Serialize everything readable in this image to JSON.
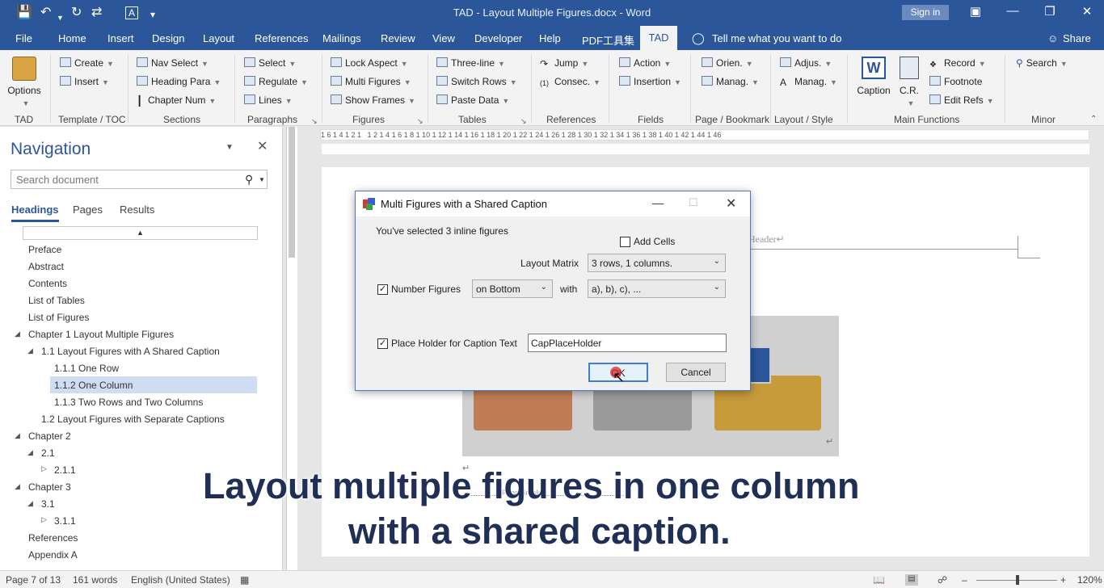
{
  "app": {
    "title": "TAD - Layout Multiple Figures.docx - Word",
    "signin": "Sign in"
  },
  "menu_tabs": [
    "File",
    "Home",
    "Insert",
    "Design",
    "Layout",
    "References",
    "Mailings",
    "Review",
    "View",
    "Developer",
    "Help",
    "PDF工具集",
    "TAD"
  ],
  "tell_me": "Tell me what you want to do",
  "share": "Share",
  "ribbon": {
    "options": "Options",
    "template_toc": {
      "create": "Create",
      "insert": "Insert",
      "label": "Template / TOC"
    },
    "tad_label": "TAD",
    "sections": {
      "nav_select": "Nav Select",
      "heading_para": "Heading Para",
      "chapter_num": "Chapter Num",
      "label": "Sections"
    },
    "paragraphs": {
      "select": "Select",
      "regulate": "Regulate",
      "lines": "Lines",
      "label": "Paragraphs"
    },
    "figures": {
      "lock_aspect": "Lock Aspect",
      "multi_figures": "Multi Figures",
      "show_frames": "Show Frames",
      "label": "Figures"
    },
    "tables": {
      "three_line": "Three-line",
      "switch_rows": "Switch Rows",
      "paste_data": "Paste Data",
      "label": "Tables"
    },
    "references": {
      "jump": "Jump",
      "consec": "Consec.",
      "label": "References"
    },
    "fields": {
      "action": "Action",
      "insertion": "Insertion",
      "label": "Fields"
    },
    "page_bookmark": {
      "orien": "Orien.",
      "manag": "Manag.",
      "label": "Page / Bookmark"
    },
    "layout_style": {
      "adjus": "Adjus.",
      "manag": "Manag.",
      "label": "Layout / Style"
    },
    "main_functions": {
      "caption": "Caption",
      "cr": "C.R.",
      "record": "Record",
      "footnote": "Footnote",
      "edit_refs": "Edit Refs",
      "label": "Main Functions"
    },
    "minor": {
      "search": "Search",
      "label": "Minor"
    }
  },
  "nav": {
    "title": "Navigation",
    "search_placeholder": "Search document",
    "tabs": [
      "Headings",
      "Pages",
      "Results"
    ],
    "items": [
      "Preface",
      "Abstract",
      "Contents",
      "List of Tables",
      "List of Figures",
      "Chapter 1 Layout Multiple Figures",
      "1.1 Layout Figures with A Shared Caption",
      "1.1.1 One Row",
      "1.1.2 One Column",
      "1.1.3 Two Rows and Two Columns",
      "1.2 Layout Figures with Separate Captions",
      "Chapter 2",
      "2.1",
      "2.1.1",
      "Chapter 3",
      "3.1",
      "3.1.1",
      "References",
      "Appendix A"
    ]
  },
  "hruler_text": "1 6 1 4 1 2 1   1 2 1 4 1 6 1 8 1 10 1 12 1 14 1 16 1 18 1 20 1 22 1 24 1 26 1 28 1 30 1 32 1 34 1 36 1 38 1 40 1 42 1 44 1 46",
  "document": {
    "header_text": "Header↵",
    "para_mark": "↵",
    "page_break": "Page Break"
  },
  "dialog": {
    "title": "Multi Figures with a Shared Caption",
    "selected_info": "You've selected 3 inline figures",
    "add_cells": "Add Cells",
    "layout_matrix_label": "Layout Matrix",
    "layout_matrix_value": "3 rows, 1 columns.",
    "number_figures": "Number Figures",
    "position_value": "on Bottom",
    "with_label": "with",
    "numbering_value": "a), b), c), ...",
    "placeholder_label": "Place Holder for Caption Text",
    "placeholder_value": "CapPlaceHolder",
    "ok": "OK",
    "cancel": "Cancel"
  },
  "overlay": {
    "line1": "Layout multiple figures in one column",
    "line2": "with a shared caption."
  },
  "status": {
    "page": "Page 7 of 13",
    "words": "161 words",
    "language": "English (United States)",
    "zoom": "120%"
  }
}
